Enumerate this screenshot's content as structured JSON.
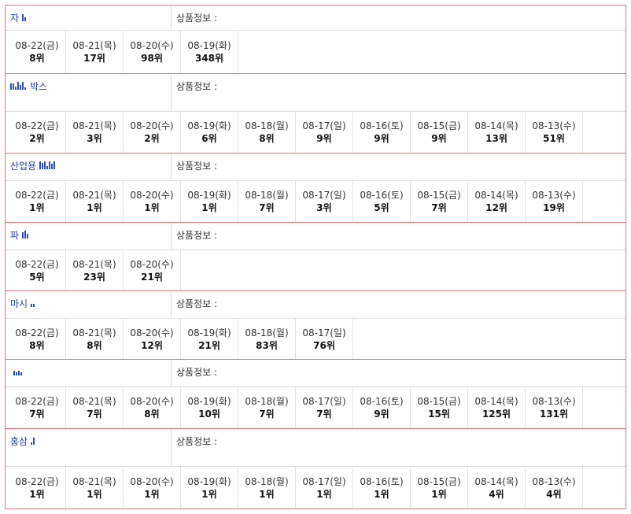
{
  "info_label": "상품정보 :",
  "products": [
    {
      "name": "자",
      "mask": [
        9,
        5
      ],
      "head_h": 32,
      "rank_h": 54,
      "ranks": [
        {
          "date": "08-22(금)",
          "rank": "8위"
        },
        {
          "date": "08-21(목)",
          "rank": "17위"
        },
        {
          "date": "08-20(수)",
          "rank": "98위"
        },
        {
          "date": "08-19(화)",
          "rank": "348위"
        }
      ]
    },
    {
      "name": "박스",
      "name_prefix_mask": [
        8,
        8,
        4,
        10,
        6,
        10,
        3
      ],
      "mask": [],
      "head_h": 48,
      "rank_h": 52,
      "ranks": [
        {
          "date": "08-22(금)",
          "rank": "2위"
        },
        {
          "date": "08-21(목)",
          "rank": "3위"
        },
        {
          "date": "08-20(수)",
          "rank": "2위"
        },
        {
          "date": "08-19(화)",
          "rank": "6위"
        },
        {
          "date": "08-18(월)",
          "rank": "8위"
        },
        {
          "date": "08-17(일)",
          "rank": "9위"
        },
        {
          "date": "08-16(토)",
          "rank": "9위"
        },
        {
          "date": "08-15(금)",
          "rank": "9위"
        },
        {
          "date": "08-14(목)",
          "rank": "13위"
        },
        {
          "date": "08-13(수)",
          "rank": "51위"
        }
      ]
    },
    {
      "name": "산업용",
      "mask": [
        10,
        8,
        10,
        4,
        10,
        7,
        10
      ],
      "head_h": 35,
      "rank_h": 52,
      "ranks": [
        {
          "date": "08-22(금)",
          "rank": "1위"
        },
        {
          "date": "08-21(목)",
          "rank": "1위"
        },
        {
          "date": "08-20(수)",
          "rank": "1위"
        },
        {
          "date": "08-19(화)",
          "rank": "1위"
        },
        {
          "date": "08-18(월)",
          "rank": "7위"
        },
        {
          "date": "08-17(일)",
          "rank": "3위"
        },
        {
          "date": "08-16(토)",
          "rank": "5위"
        },
        {
          "date": "08-15(금)",
          "rank": "7위"
        },
        {
          "date": "08-14(목)",
          "rank": "12위"
        },
        {
          "date": "08-13(수)",
          "rank": "19위"
        }
      ]
    },
    {
      "name": "파",
      "mask": [
        8,
        10,
        6
      ],
      "head_h": 35,
      "rank_h": 51,
      "ranks": [
        {
          "date": "08-22(금)",
          "rank": "5위"
        },
        {
          "date": "08-21(목)",
          "rank": "23위"
        },
        {
          "date": "08-20(수)",
          "rank": "21위"
        }
      ]
    },
    {
      "name": "마시",
      "mask": [
        4,
        4
      ],
      "head_h": 35,
      "rank_h": 51,
      "ranks": [
        {
          "date": "08-22(금)",
          "rank": "8위"
        },
        {
          "date": "08-21(목)",
          "rank": "8위"
        },
        {
          "date": "08-20(수)",
          "rank": "12위"
        },
        {
          "date": "08-19(화)",
          "rank": "21위"
        },
        {
          "date": "08-18(월)",
          "rank": "83위"
        },
        {
          "date": "08-17(일)",
          "rank": "76위"
        }
      ]
    },
    {
      "name": "",
      "mask": [
        6,
        4,
        6,
        4
      ],
      "head_h": 35,
      "rank_h": 52,
      "ranks": [
        {
          "date": "08-22(금)",
          "rank": "7위"
        },
        {
          "date": "08-21(목)",
          "rank": "7위"
        },
        {
          "date": "08-20(수)",
          "rank": "8위"
        },
        {
          "date": "08-19(화)",
          "rank": "10위"
        },
        {
          "date": "08-18(월)",
          "rank": "7위"
        },
        {
          "date": "08-17(일)",
          "rank": "7위"
        },
        {
          "date": "08-16(토)",
          "rank": "9위"
        },
        {
          "date": "08-15(금)",
          "rank": "15위"
        },
        {
          "date": "08-14(목)",
          "rank": "125위"
        },
        {
          "date": "08-13(수)",
          "rank": "131위"
        }
      ]
    },
    {
      "name": "홍삼",
      "mask": [
        3,
        9
      ],
      "head_h": 48,
      "rank_h": 53,
      "ranks": [
        {
          "date": "08-22(금)",
          "rank": "1위"
        },
        {
          "date": "08-21(목)",
          "rank": "1위"
        },
        {
          "date": "08-20(수)",
          "rank": "1위"
        },
        {
          "date": "08-19(화)",
          "rank": "1위"
        },
        {
          "date": "08-18(월)",
          "rank": "1위"
        },
        {
          "date": "08-17(일)",
          "rank": "1위"
        },
        {
          "date": "08-16(토)",
          "rank": "1위"
        },
        {
          "date": "08-15(금)",
          "rank": "1위"
        },
        {
          "date": "08-14(목)",
          "rank": "4위"
        },
        {
          "date": "08-13(수)",
          "rank": "4위"
        }
      ]
    }
  ]
}
